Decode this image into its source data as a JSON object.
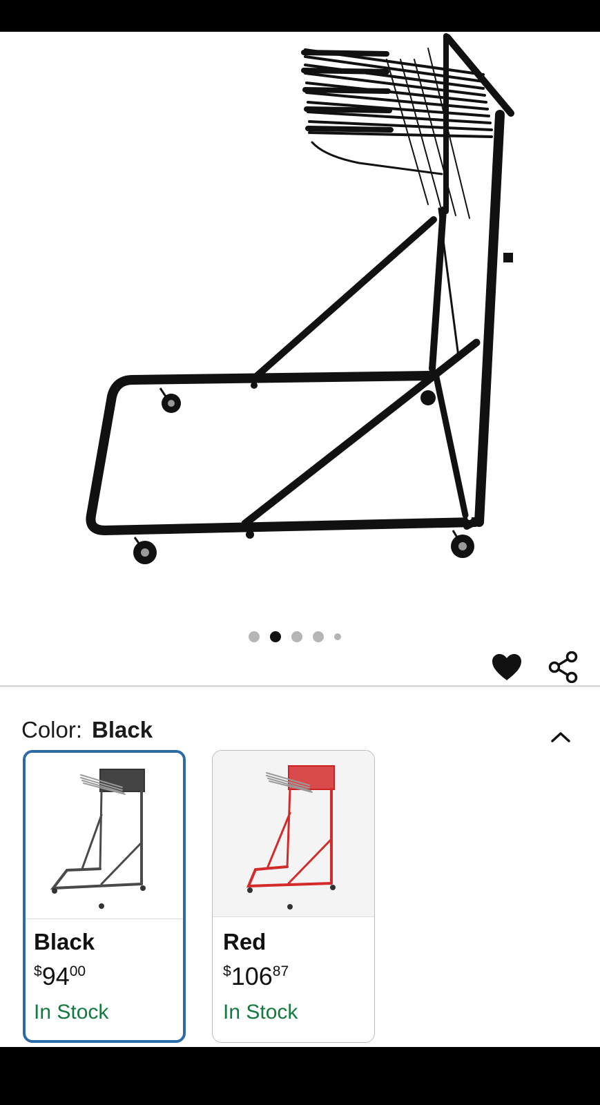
{
  "product": {
    "image_alt": "Black rolling blueprint rack"
  },
  "gallery": {
    "dots_total": 5,
    "active_index": 1
  },
  "actions": {
    "favorite_icon": "heart-icon",
    "share_icon": "share-icon"
  },
  "color_selector": {
    "label": "Color:",
    "selected": "Black",
    "collapse_icon": "chevron-up-icon"
  },
  "variants": [
    {
      "name": "Black",
      "currency": "$",
      "price_whole": "94",
      "price_cents": "00",
      "stock": "In Stock",
      "frame_color": "#4a4a4a"
    },
    {
      "name": "Red",
      "currency": "$",
      "price_whole": "106",
      "price_cents": "87",
      "stock": "In Stock",
      "frame_color": "#d32a2a"
    }
  ],
  "colors": {
    "selected_border": "#2e6aa8",
    "stock_green": "#137a3f"
  }
}
